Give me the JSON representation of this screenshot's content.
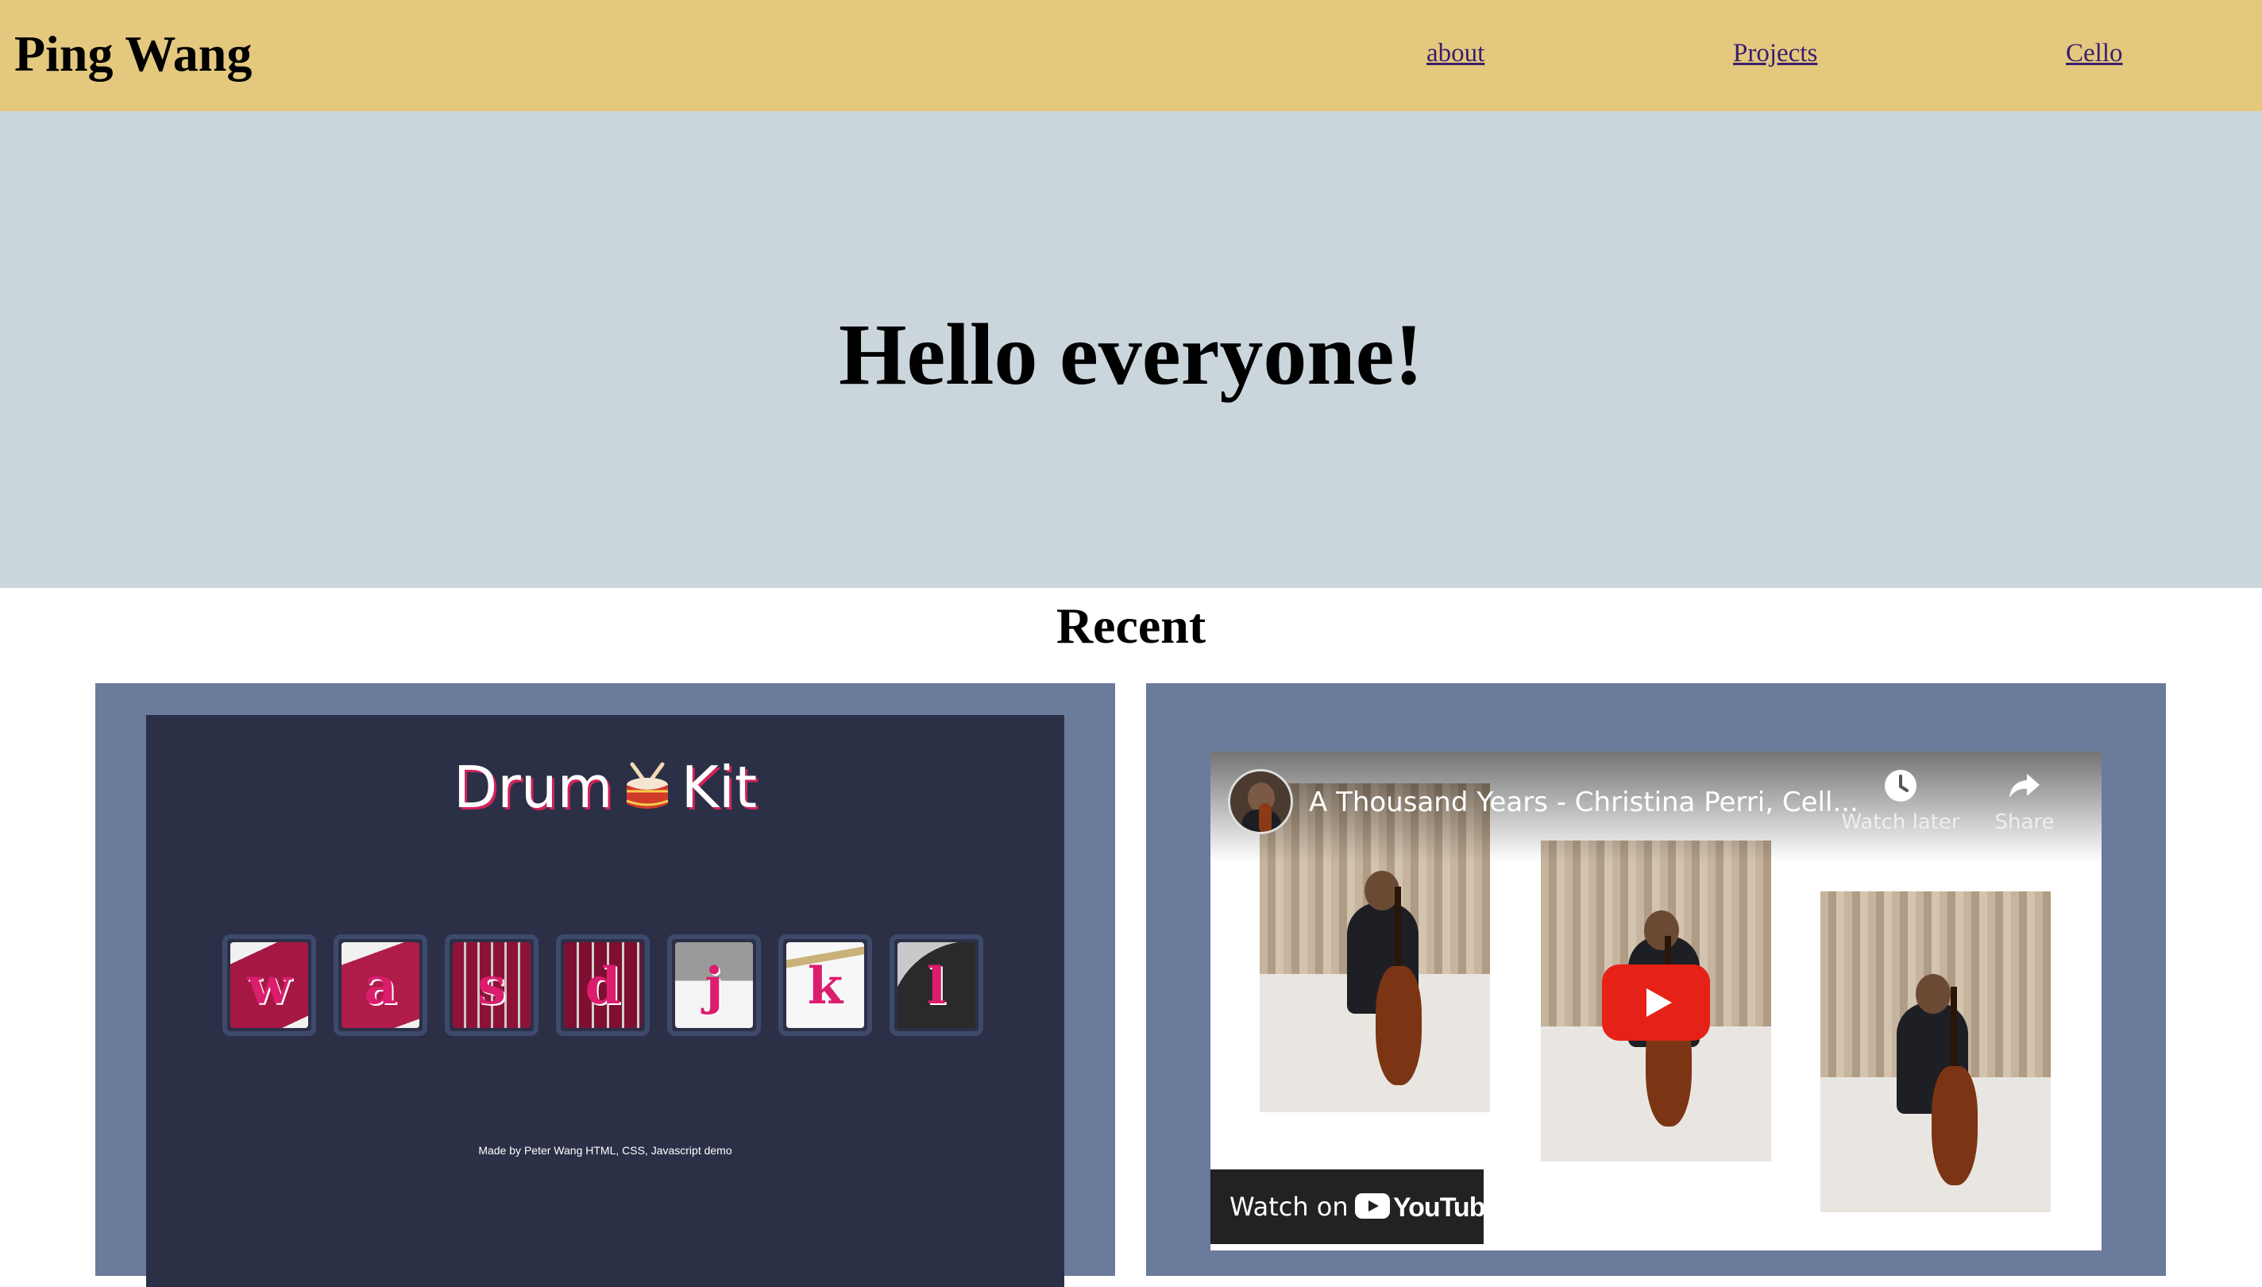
{
  "header": {
    "brand": "Ping Wang",
    "nav": [
      "about",
      "Projects",
      "Cello"
    ],
    "background": "#e3c87e"
  },
  "hero": {
    "title": "Hello everyone!",
    "background": "#cbd6dc"
  },
  "recent": {
    "heading": "Recent",
    "card_background": "#6a7b9b"
  },
  "drum_kit": {
    "title_left": "Drum",
    "title_emoji_icon": "drum-icon",
    "title_right": "Kit",
    "keys": [
      "w",
      "a",
      "s",
      "d",
      "j",
      "k",
      "l"
    ],
    "credit": "Made by Peter Wang HTML, CSS, Javascript demo",
    "background": "#2b3047",
    "key_color": "#db1d6e"
  },
  "video": {
    "title": "A Thousand Years - Christina Perri, Cell...",
    "watch_later": "Watch later",
    "share": "Share",
    "watch_on": "Watch on",
    "youtube": "YouTube",
    "play_color": "#e62117"
  }
}
